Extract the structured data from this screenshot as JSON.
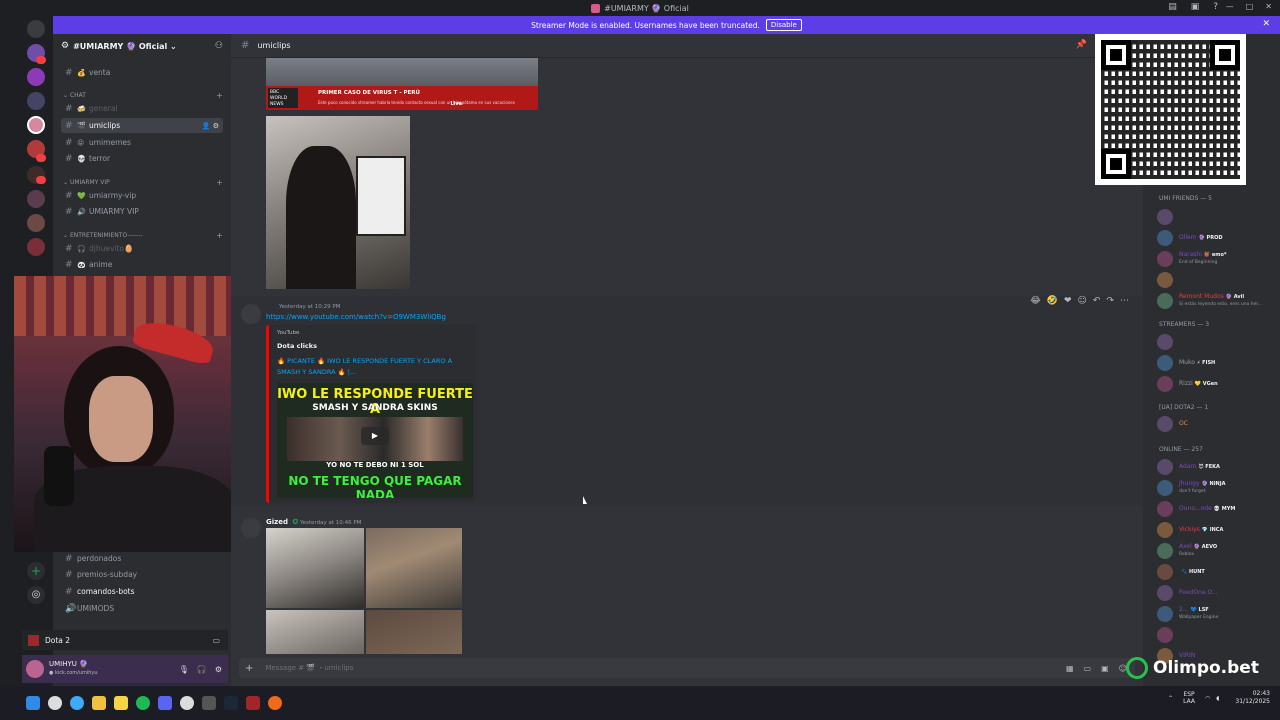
{
  "window": {
    "title": "#UMIARMY 🔮 Oficial"
  },
  "banner": {
    "text": "Streamer Mode is enabled. Usernames have been truncated.",
    "button": "Disable"
  },
  "server": {
    "name": "#UMIARMY 🔮 Oficial"
  },
  "channels_top": [
    {
      "name": "venta",
      "emoji": "💰",
      "state": "normal"
    }
  ],
  "categories": {
    "chat": "Chat",
    "vip": "UMIARMY VIP",
    "ent": "ENTRETENIMIENTO-------"
  },
  "chat_channels": [
    {
      "name": "general",
      "emoji": "🍻",
      "state": "dim"
    },
    {
      "name": "umiclips",
      "emoji": "🎬",
      "state": "active"
    },
    {
      "name": "umimemes",
      "emoji": "😝",
      "state": "normal"
    },
    {
      "name": "terror",
      "emoji": "💀",
      "state": "normal"
    }
  ],
  "vip_channels": [
    {
      "name": "umiarmy-vip",
      "emoji": "💚",
      "state": "normal"
    },
    {
      "name": "UMIARMY VIP",
      "emoji": "🔊",
      "state": "normal"
    }
  ],
  "ent_channels": [
    {
      "name": "djhuevito🥚",
      "emoji": "🎧",
      "state": "dim"
    },
    {
      "name": "anime",
      "emoji": "🐼",
      "state": "normal"
    }
  ],
  "bottom_channels": [
    {
      "name": "perdonados",
      "state": "normal"
    },
    {
      "name": "premios-subday",
      "state": "normal"
    },
    {
      "name": "comandos-bots",
      "state": "bold"
    },
    {
      "name": "UMIMODS",
      "state": "normal"
    }
  ],
  "voice": {
    "label": "Dota 2"
  },
  "user": {
    "name": "UMIHYU 🔮",
    "sub": "● kick.com/umihyu"
  },
  "main": {
    "channel": "umiclips",
    "news": {
      "logo": "BBC WORLD NEWS",
      "headline": "PRIMER CASO DE VIRUS T - PERÚ",
      "sub": "Este poco conocido streamer habría tenido contacto sexual con un hipopótamo en sus vacaciones",
      "live": "Live"
    },
    "msg1": {
      "time": "Yesterday at 10:29 PM",
      "link": "https://www.youtube.com/watch?v=O9WM3WliQBg"
    },
    "embed": {
      "provider": "YouTube",
      "author": "Dota clicks",
      "title": "🔥 PICANTE 🔥 IWO LE RESPONDE FUERTE Y CLARO A SMASH Y SANDRA 🔥 |...",
      "thumb_line1": "IWO LE RESPONDE FUERTE A",
      "thumb_line2": "SMASH Y SANDRA SKINS",
      "thumb_line3": "YO NO TE DEBO NI 1 SOL",
      "thumb_line4": "NO TE TENGO QUE PAGAR NADA"
    },
    "msg2": {
      "author": "Gized",
      "time": "Yesterday at 10:46 PM"
    },
    "composer": "Message # 🎬 ・umiclips"
  },
  "members": {
    "sections": [
      "UMI FRIENDS — 5",
      "STREAMERS — 3",
      "[UA] Dota2 — 1",
      "Online — 257"
    ],
    "umi_friends": [
      {
        "name": "",
        "tag": "",
        "status": "",
        "color": "red"
      },
      {
        "name": "Ollem",
        "tag": "🔮 PROD",
        "status": "",
        "color": "purple"
      },
      {
        "name": "Narashi",
        "tag": "👹 emo*",
        "status": "End of Beginning",
        "color": "purple"
      },
      {
        "name": "",
        "tag": "",
        "status": "",
        "color": "red"
      },
      {
        "name": "Remont Mudos",
        "tag": "🔮 Avil",
        "status": "Si estás leyendo esto, eres una her...",
        "color": "red"
      }
    ],
    "streamers": [
      {
        "name": "",
        "tag": "",
        "status": "",
        "color": "gray"
      },
      {
        "name": "Muko",
        "tag": "⚡ FISH",
        "status": "",
        "color": "gray"
      },
      {
        "name": "Rizzi",
        "tag": "💛 VGen",
        "status": "",
        "color": "gray"
      }
    ],
    "dota": [
      {
        "name": "OC",
        "tag": "",
        "status": "",
        "color": "orange"
      }
    ],
    "online": [
      {
        "name": "Adam",
        "tag": "😈 FEKA",
        "status": "",
        "color": "purple"
      },
      {
        "name": "Jhungy",
        "tag": "🔮 NINJA",
        "status": "don't forget",
        "color": "purple"
      },
      {
        "name": "Ouno...ode",
        "tag": "💀 MYM",
        "status": "",
        "color": "purple"
      },
      {
        "name": "Vickiys",
        "tag": "💎 INCA",
        "status": "",
        "color": "red"
      },
      {
        "name": "Axel",
        "tag": "🔮 AEVO",
        "status": "Roblox",
        "color": "purple"
      },
      {
        "name": "",
        "tag": "🐾 HUNT",
        "status": "",
        "color": "purple"
      },
      {
        "name": "FeedOne.O...",
        "tag": "",
        "status": "",
        "color": "purple"
      },
      {
        "name": "2...",
        "tag": "💙 LSF",
        "status": "Wallpaper Engine",
        "color": "purple"
      },
      {
        "name": "",
        "tag": "",
        "status": "",
        "color": "purple"
      },
      {
        "name": "VIRIN",
        "tag": "",
        "status": "",
        "color": "purple"
      }
    ]
  },
  "sponsor": {
    "name": "Olimpo.bet"
  },
  "taskbar": {
    "lang1": "ESP",
    "lang2": "LAA",
    "time": "02:43",
    "date": "31/12/2025"
  }
}
